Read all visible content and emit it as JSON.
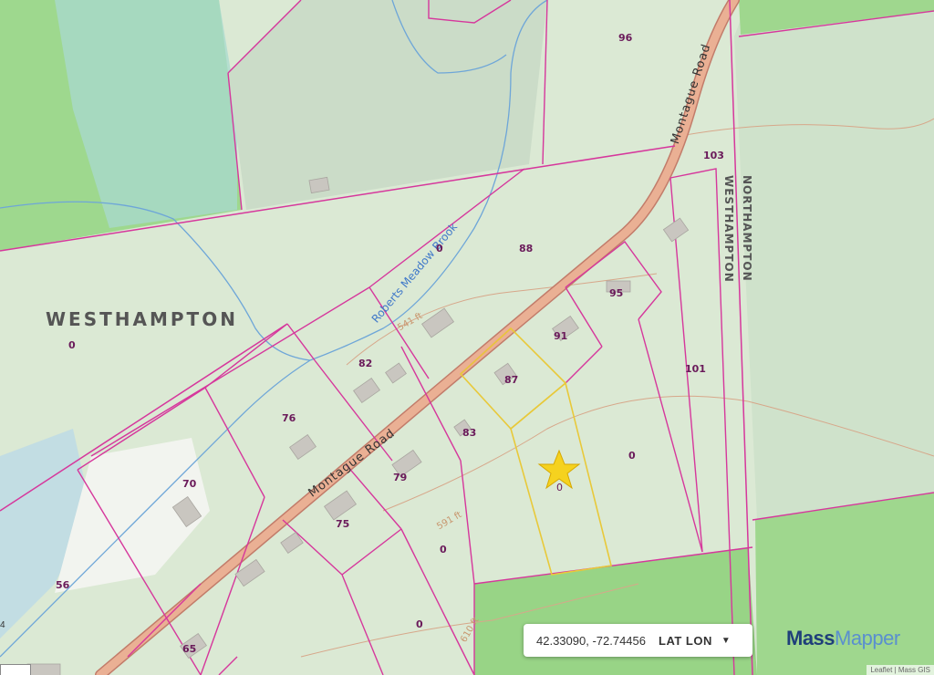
{
  "map": {
    "towns": [
      {
        "name": "WESTHAMPTON"
      },
      {
        "name": "WESTHAMPTON"
      },
      {
        "name": "NORTHAMPTON"
      }
    ],
    "roads": [
      {
        "name": "Montague Road"
      },
      {
        "name": "Montague Road"
      }
    ],
    "waterway": "Roberts Meadow Brook",
    "contours": [
      "541 ft",
      "591 ft",
      "610 ft"
    ],
    "parcel_numbers": [
      "96",
      "103",
      "0",
      "88",
      "95",
      "91",
      "87",
      "101",
      "82",
      "76",
      "83",
      "79",
      "0",
      "70",
      "75",
      "0",
      "56",
      "65",
      "0",
      "0"
    ],
    "colors": {
      "parcel_line": "#d6379c",
      "selected_parcel": "#e8c93a",
      "road_fill": "#e9a98c",
      "stream": "#6ea6d8",
      "forest": "#9bd88a",
      "marker": "#f5d21f"
    },
    "marker_icon": "star-icon"
  },
  "coordinates": {
    "value": "42.33090, -72.74456",
    "mode": "LAT LON"
  },
  "brand": {
    "part1": "Mass",
    "part2": "Mapper"
  },
  "attribution": "Leaflet | Mass GIS",
  "edge_label": "4"
}
